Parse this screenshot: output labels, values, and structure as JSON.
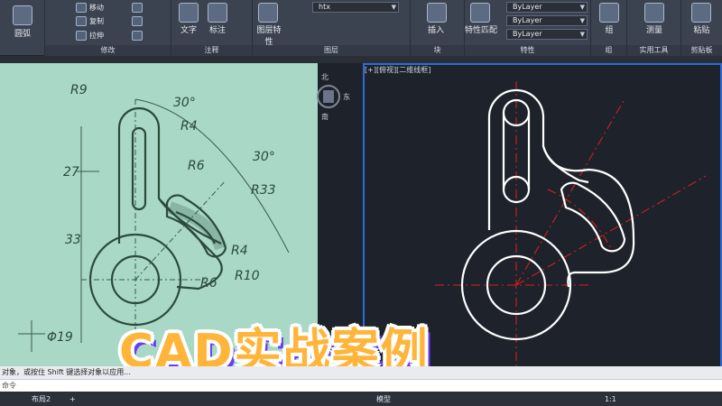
{
  "ribbon": {
    "modify_panel": {
      "title": "修改",
      "tools": [
        "移动",
        "复制",
        "拉伸"
      ]
    },
    "draw_panel": {
      "title": "圆弧"
    },
    "annotation_panel": {
      "title": "注释",
      "tools": [
        "文字",
        "标注"
      ]
    },
    "layers_panel": {
      "title": "图层",
      "tools": [
        "图层特性"
      ],
      "layer_value": "htx"
    },
    "block_panel": {
      "title": "块",
      "tools": [
        "插入"
      ]
    },
    "properties_panel": {
      "title": "特性",
      "tools": [
        "特性匹配"
      ],
      "bylayer_1": "ByLayer",
      "bylayer_2": "ByLayer",
      "bylayer_3": "ByLayer"
    },
    "groups_panel": {
      "title": "组",
      "tools": [
        "组"
      ]
    },
    "utilities_panel": {
      "title": "实用工具",
      "tools": [
        "测量"
      ]
    },
    "clipboard_panel": {
      "title": "剪贴板",
      "tools": [
        "粘贴"
      ]
    }
  },
  "photo_annotations": {
    "r9": "R9",
    "a30_top": "30°",
    "r4_top": "R4",
    "r6_mid": "R6",
    "a30_right": "30°",
    "r33": "R33",
    "d27": "27",
    "d33": "33",
    "r4_bot": "R4",
    "r10": "R10",
    "r6_bot": "R6",
    "phi19": "Φ19"
  },
  "viewport": {
    "label": "[+][俯视][二维线框]",
    "compass_n": "北",
    "compass_e": "东",
    "compass_s": "南"
  },
  "command": {
    "line": "对象，或按住 Shift 键选择对象以应用...",
    "prompt": "命令"
  },
  "status": {
    "layout_tab": "布局2",
    "model": "模型",
    "scale": "1:1"
  },
  "overlay_title": "CAD实战案例",
  "colors": {
    "accent_orange": "#ffb43a",
    "viewport_border": "#2e6bd8",
    "centerline_red": "#e02020"
  }
}
